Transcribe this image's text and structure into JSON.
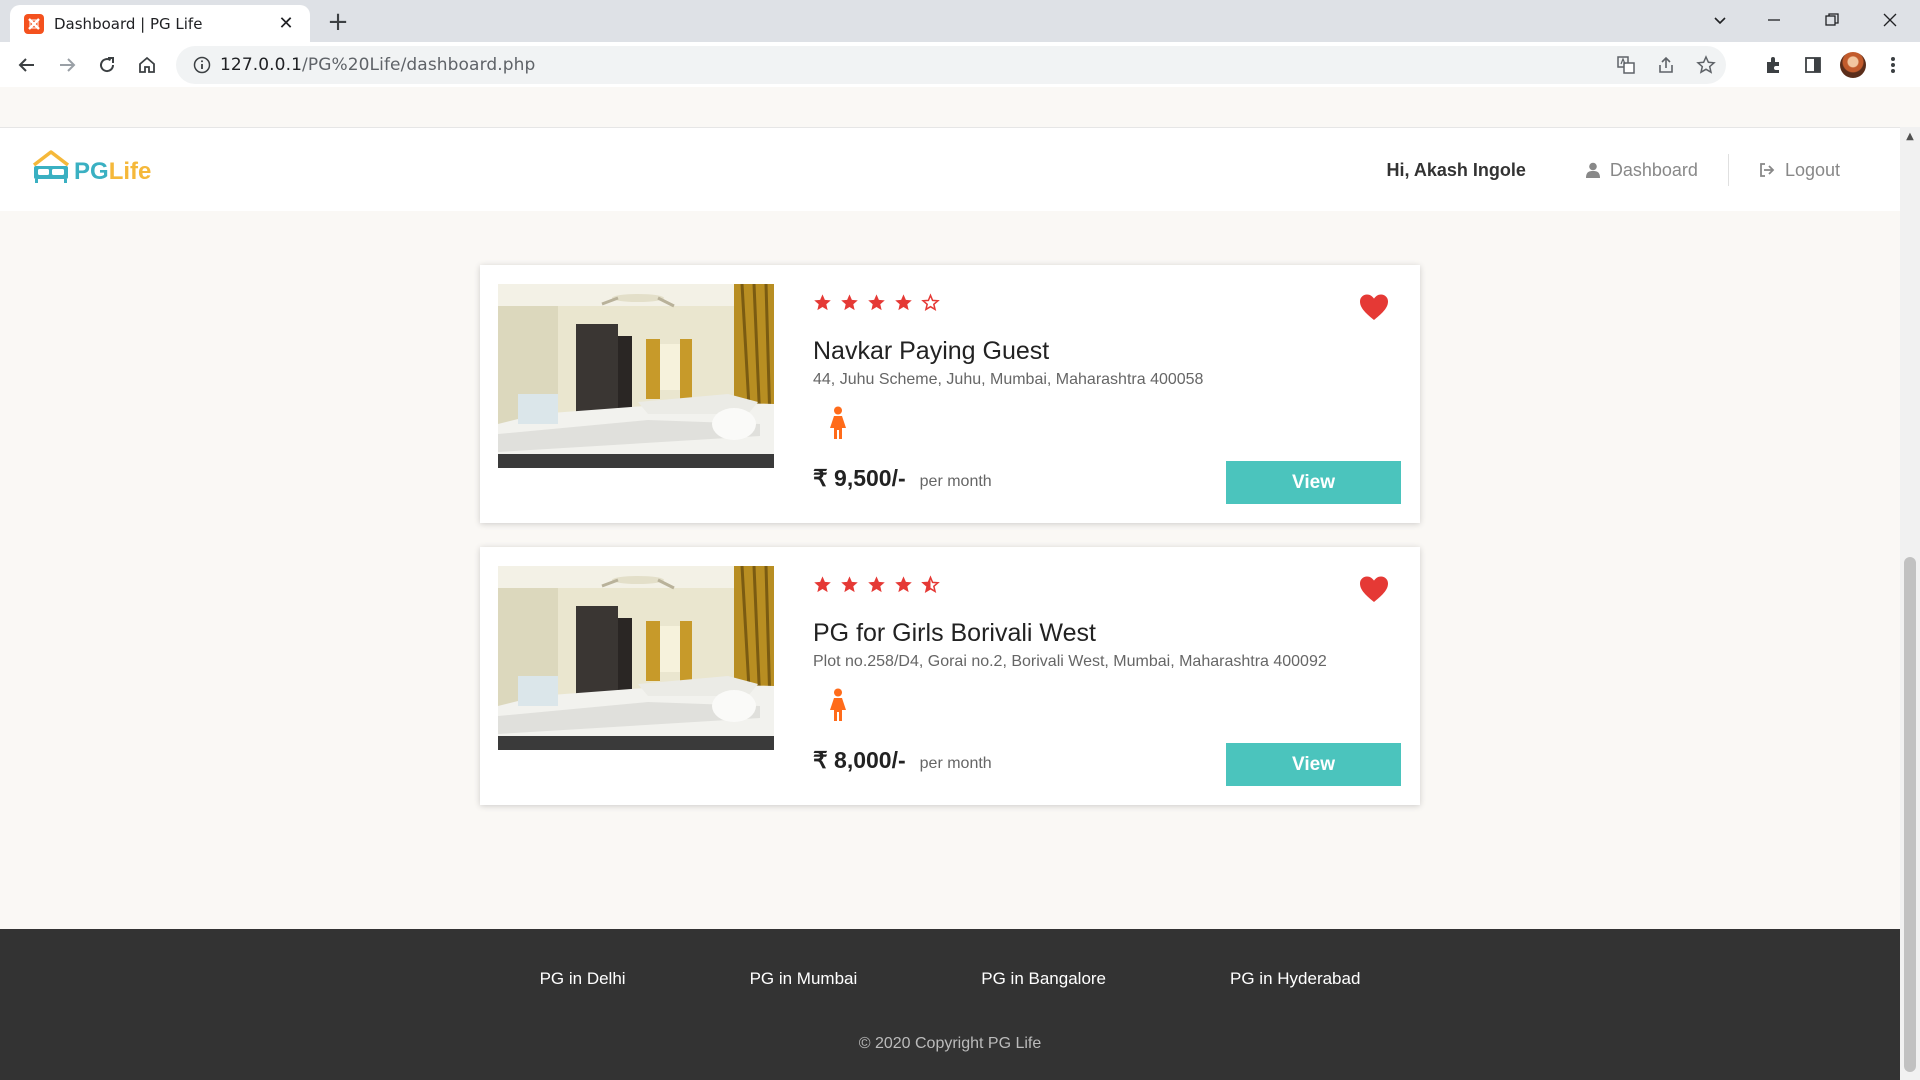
{
  "browser": {
    "tab_title": "Dashboard | PG Life",
    "url_host": "127.0.0.1",
    "url_path": "/PG%20Life/dashboard.php"
  },
  "header": {
    "logo_pg": "PG",
    "logo_life": "Life",
    "greeting": "Hi, Akash Ingole",
    "dashboard_label": "Dashboard",
    "logout_label": "Logout"
  },
  "properties": [
    {
      "name": "Navkar Paying Guest",
      "address": "44, Juhu Scheme, Juhu, Mumbai, Maharashtra 400058",
      "rating": 4.0,
      "price": "₹ 9,500/-",
      "per": "per month",
      "view_label": "View",
      "gender": "female",
      "interested": true
    },
    {
      "name": "PG for Girls Borivali West",
      "address": "Plot no.258/D4, Gorai no.2, Borivali West, Mumbai, Maharashtra 400092",
      "rating": 4.5,
      "price": "₹ 8,000/-",
      "per": "per month",
      "view_label": "View",
      "gender": "female",
      "interested": true
    }
  ],
  "footer": {
    "links": [
      "PG in Delhi",
      "PG in Mumbai",
      "PG in Bangalore",
      "PG in Hyderabad"
    ],
    "copyright": "© 2020 Copyright PG Life"
  },
  "colors": {
    "accent": "#4bc4bd",
    "star": "#e53935",
    "heart": "#e53935",
    "gender": "#ff6b1a",
    "footer_bg": "#333333"
  }
}
